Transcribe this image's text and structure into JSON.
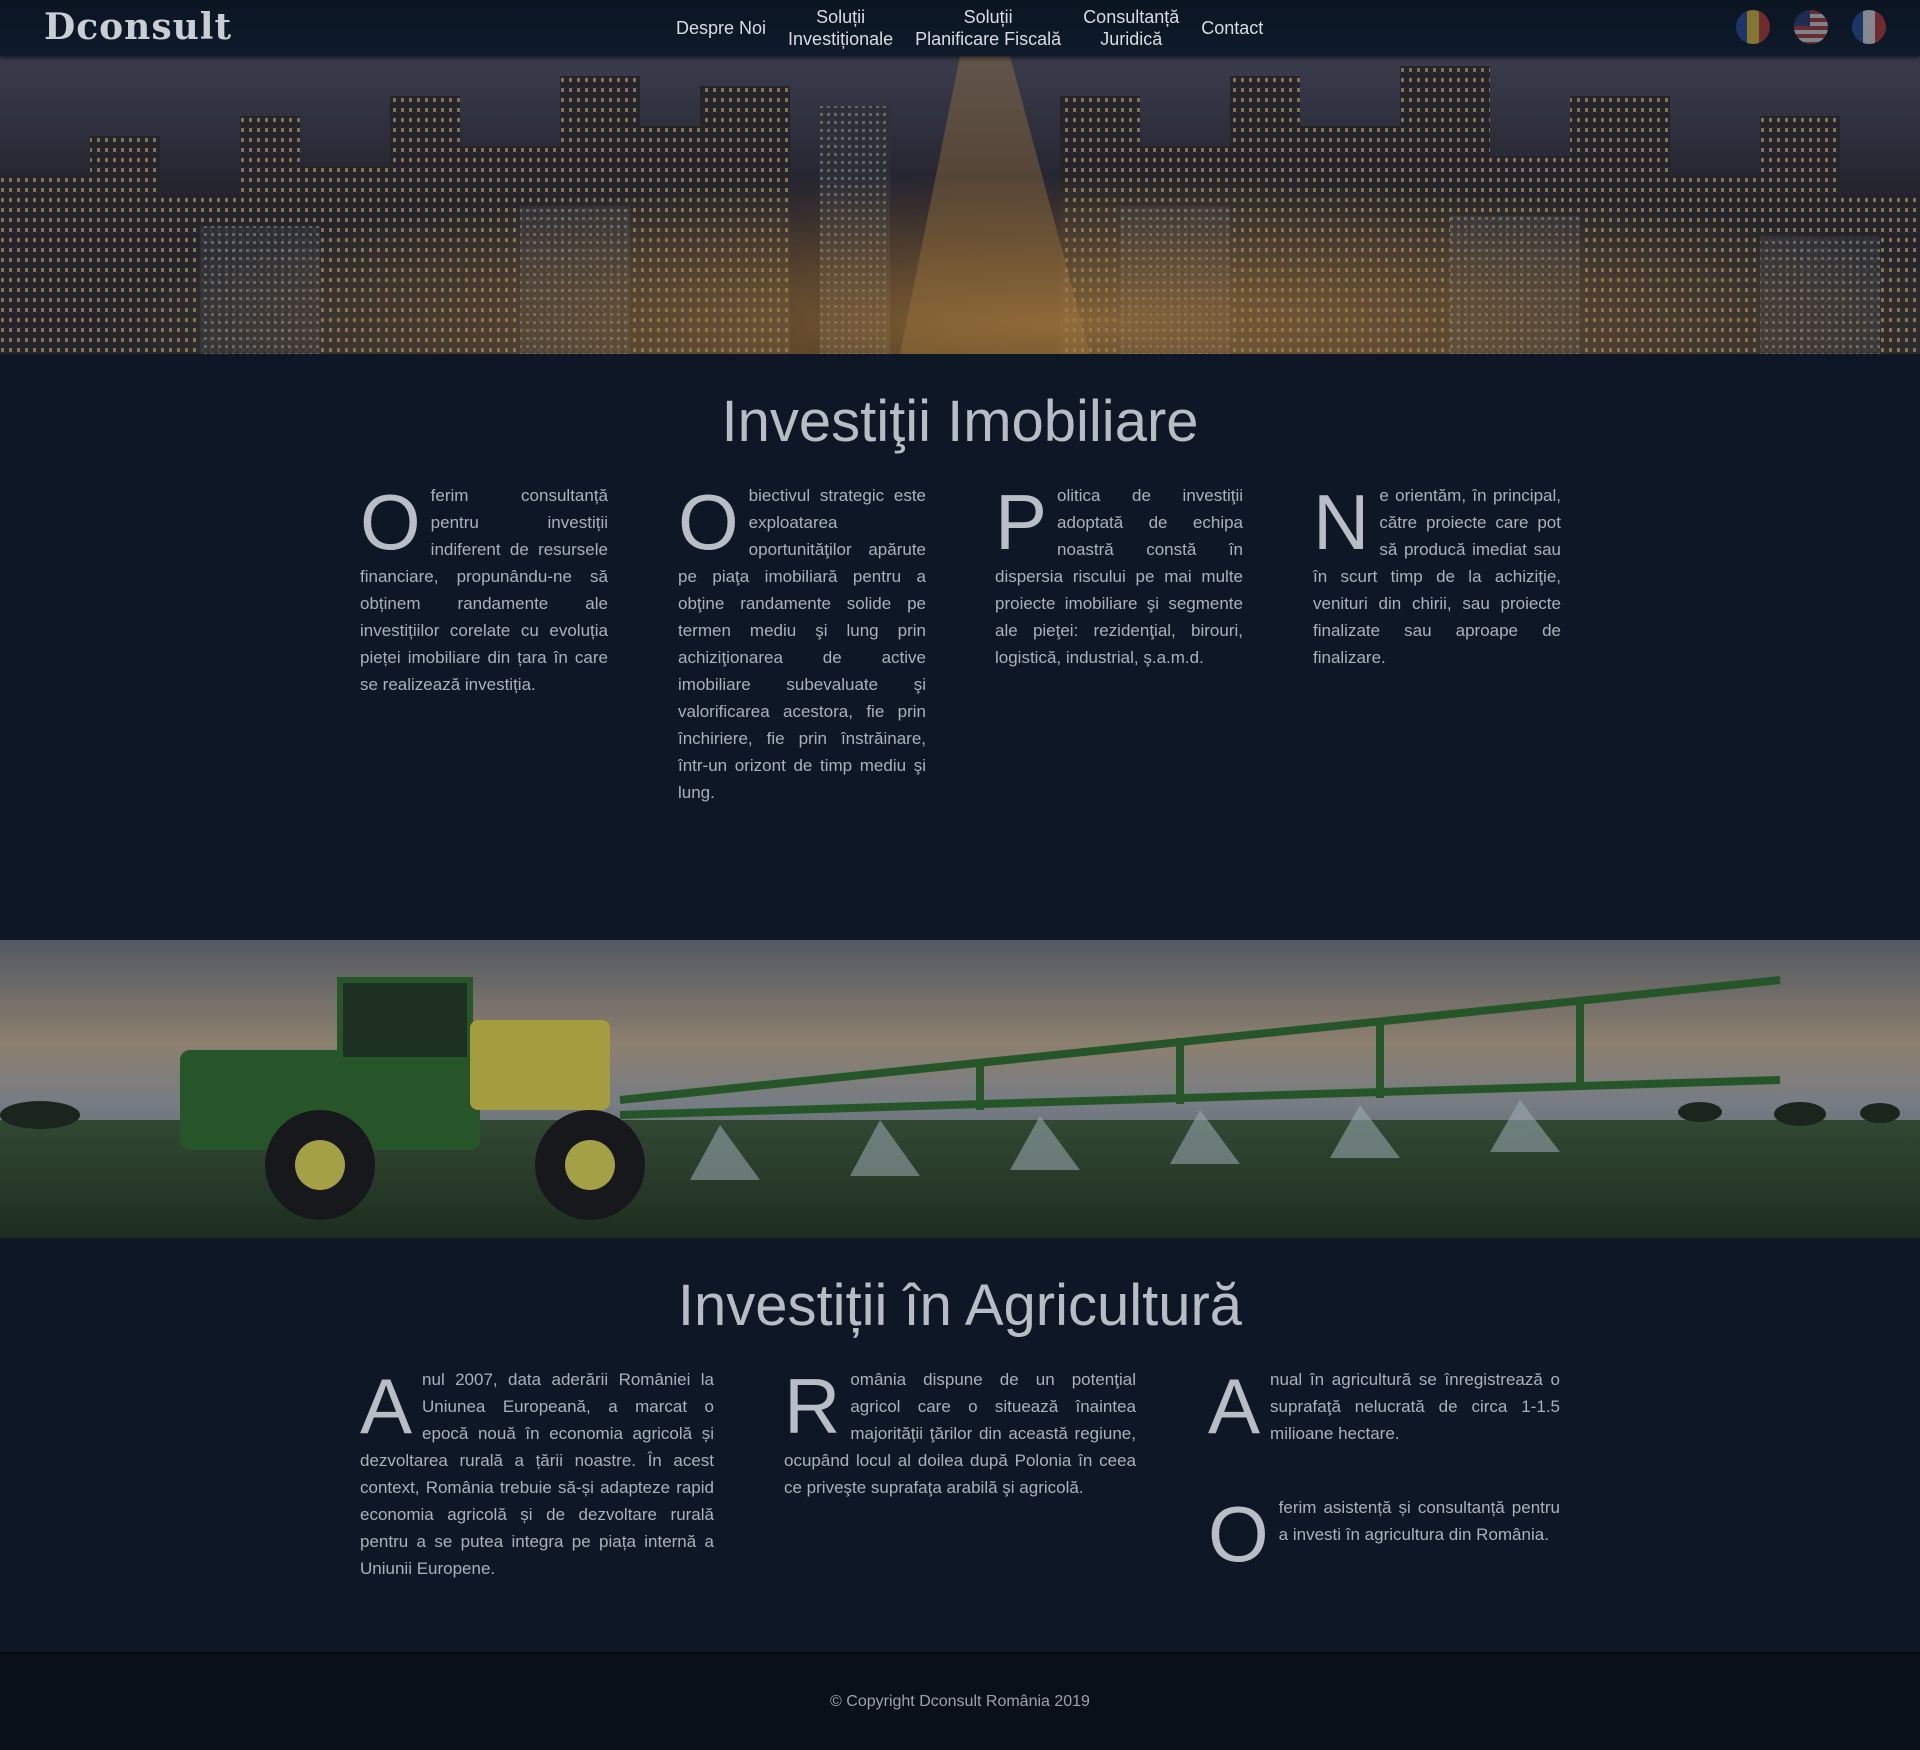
{
  "header": {
    "logo": "Dconsult",
    "menu": [
      {
        "line1": "Despre Noi",
        "line2": ""
      },
      {
        "line1": "Soluții",
        "line2": "Investiționale"
      },
      {
        "line1": "Soluții",
        "line2": "Planificare Fiscală"
      },
      {
        "line1": "Consultanță",
        "line2": "Juridică"
      },
      {
        "line1": "Contact",
        "line2": ""
      }
    ],
    "flags": [
      "romania-flag-icon",
      "usa-flag-icon",
      "france-flag-icon"
    ]
  },
  "real_estate": {
    "title": "Investiţii Imobiliare",
    "paragraphs": [
      {
        "initial": "O",
        "rest": "ferim consultanță pentru investiții indiferent de resursele financiare, propunându-ne să obținem randamente ale investițiilor corelate cu evoluția pieței imobiliare din țara în care se realizează investiția."
      },
      {
        "initial": "O",
        "rest": "biectivul strategic este exploatarea oportunităţilor apărute pe piaţa imobiliară pentru a obţine randamente solide pe termen mediu şi lung prin achiziţionarea de active imobiliare subevaluate şi valorificarea acestora, fie prin închiriere, fie prin înstrăinare, într-un orizont de timp mediu şi lung."
      },
      {
        "initial": "P",
        "rest": "olitica de investiţii adoptată de echipa noastră constă în dispersia riscului pe mai multe proiecte imobiliare şi segmente ale pieţei: rezidenţial, birouri, logistică, industrial, ş.a.m.d."
      },
      {
        "initial": "N",
        "rest": "e orientăm, în principal, către proiecte care pot să producă imediat sau în scurt timp de la achiziţie, venituri din chirii, sau proiecte finalizate sau aproape de finalizare."
      }
    ]
  },
  "agriculture": {
    "title": "Investiții în Agricultură",
    "paragraphs": [
      {
        "initial": "A",
        "rest": "nul 2007, data aderării României la Uniunea Europeană, a marcat o epocă nouă în economia agricolă și dezvoltarea rurală a țării noastre. În acest context, România trebuie să-și adapteze rapid economia agricolă și de dezvoltare rurală pentru a se putea integra pe piața internă a Uniunii Europene."
      },
      {
        "initial": "R",
        "rest": "omânia dispune de un potenţial agricol care o situează înaintea majorităţii ţărilor din această regiune, ocupând locul al doilea după Polonia în ceea ce priveşte suprafaţa arabilă şi agricolă."
      },
      {
        "initial": "A",
        "rest": "nual în agricultură se înregistrează o suprafaţă nelucrată de circa 1-1.5 milioane hectare."
      },
      {
        "initial": "O",
        "rest": "ferim asistență și consultanță pentru a investi în agricultura din România."
      }
    ]
  },
  "footer": {
    "copyright": "© Copyright Dconsult România 2019"
  }
}
